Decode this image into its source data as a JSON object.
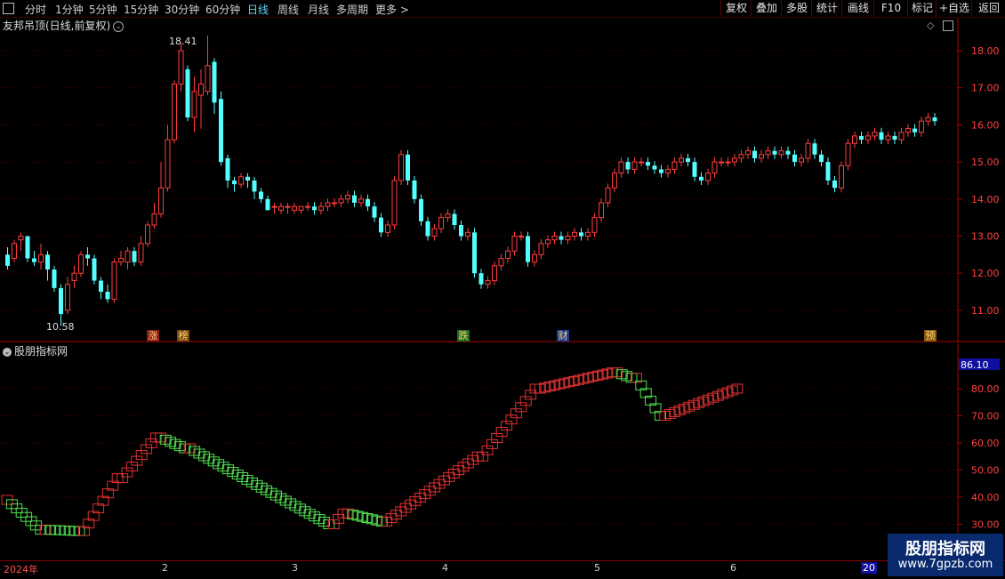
{
  "toolbar": {
    "periods": [
      "分时",
      "1分钟",
      "5分钟",
      "15分钟",
      "30分钟",
      "60分钟",
      "日线",
      "周线",
      "月线",
      "多周期",
      "更多 >"
    ],
    "active_period": "日线",
    "right_buttons": [
      "复权",
      "叠加",
      "多股",
      "统计",
      "画线",
      "F10",
      "标记",
      "+自选",
      "返回"
    ]
  },
  "main_chart": {
    "title": "友邦吊顶(日线,前复权)",
    "price_axis": [
      "18.00",
      "17.00",
      "16.00",
      "15.00",
      "14.00",
      "13.00",
      "12.00",
      "11.00"
    ],
    "high_label": "18.41",
    "low_label": "10.58",
    "events": [
      {
        "label": "涨",
        "bg": "#8b1a1a"
      },
      {
        "label": "榜",
        "bg": "#7a4a10"
      },
      {
        "label": "跌",
        "bg": "#1f6b1f"
      },
      {
        "label": "财",
        "bg": "#1a3a8b"
      },
      {
        "label": "预",
        "bg": "#8b5a10"
      }
    ],
    "colors": {
      "up": "#ff3c3c",
      "down": "#54ffff",
      "axis": "#b00000"
    }
  },
  "indicator": {
    "title": "股朋指标网",
    "axis": [
      "80.00",
      "70.00",
      "60.00",
      "50.00",
      "40.00",
      "30.00"
    ],
    "current_value": "86.10"
  },
  "dates": {
    "labels": [
      "2024年",
      "2",
      "3",
      "4",
      "5",
      "6"
    ],
    "cursor": "20"
  },
  "watermark": {
    "line1": "股朋指标网",
    "line2": "www.7gpzb.com"
  },
  "chart_data": {
    "type": "candlestick",
    "title": "友邦吊顶(日线,前复权)",
    "ylim": [
      10.5,
      18.8
    ],
    "candles": [
      [
        12.5,
        12.2,
        12.7,
        12.1
      ],
      [
        12.4,
        12.8,
        12.9,
        12.3
      ],
      [
        12.9,
        13.0,
        13.1,
        12.6
      ],
      [
        13.0,
        12.4,
        13.0,
        12.3
      ],
      [
        12.4,
        12.3,
        12.6,
        12.2
      ],
      [
        12.3,
        12.5,
        12.8,
        12.1
      ],
      [
        12.5,
        12.1,
        12.6,
        11.8
      ],
      [
        12.1,
        11.6,
        12.2,
        11.5
      ],
      [
        11.6,
        10.9,
        11.7,
        10.58
      ],
      [
        11.0,
        11.7,
        11.9,
        10.9
      ],
      [
        11.8,
        12.0,
        12.2,
        11.6
      ],
      [
        12.0,
        12.5,
        12.6,
        11.9
      ],
      [
        12.5,
        12.4,
        12.7,
        12.2
      ],
      [
        12.4,
        11.8,
        12.5,
        11.7
      ],
      [
        11.8,
        11.5,
        11.9,
        11.3
      ],
      [
        11.5,
        11.3,
        11.7,
        11.2
      ],
      [
        11.3,
        12.3,
        12.4,
        11.2
      ],
      [
        12.3,
        12.4,
        12.6,
        12.2
      ],
      [
        12.3,
        12.6,
        12.7,
        12.1
      ],
      [
        12.6,
        12.3,
        12.7,
        12.2
      ],
      [
        12.3,
        12.8,
        13.0,
        12.2
      ],
      [
        12.8,
        13.3,
        13.4,
        12.7
      ],
      [
        13.3,
        13.6,
        13.9,
        13.2
      ],
      [
        13.6,
        14.3,
        15.0,
        13.5
      ],
      [
        14.3,
        15.6,
        16.0,
        14.2
      ],
      [
        15.6,
        17.1,
        17.2,
        15.5
      ],
      [
        17.1,
        18.0,
        18.2,
        16.9
      ],
      [
        17.5,
        16.2,
        17.6,
        16.1
      ],
      [
        16.2,
        16.9,
        17.3,
        15.8
      ],
      [
        16.8,
        17.1,
        17.5,
        15.9
      ],
      [
        16.9,
        17.6,
        18.41,
        16.8
      ],
      [
        17.7,
        16.6,
        17.8,
        16.3
      ],
      [
        16.7,
        15.0,
        16.9,
        14.9
      ],
      [
        15.1,
        14.5,
        15.2,
        14.3
      ],
      [
        14.5,
        14.4,
        14.6,
        14.2
      ],
      [
        14.4,
        14.6,
        14.7,
        14.3
      ],
      [
        14.6,
        14.5,
        14.7,
        14.3
      ],
      [
        14.5,
        14.2,
        14.6,
        14.0
      ],
      [
        14.2,
        14.0,
        14.3,
        13.9
      ],
      [
        14.0,
        13.7,
        14.1,
        13.7
      ],
      [
        13.8,
        13.8,
        13.9,
        13.6
      ],
      [
        13.7,
        13.8,
        13.9,
        13.6
      ],
      [
        13.8,
        13.8,
        13.9,
        13.6
      ],
      [
        13.7,
        13.8,
        13.9,
        13.6
      ],
      [
        13.7,
        13.8,
        13.8,
        13.6
      ]
    ]
  }
}
